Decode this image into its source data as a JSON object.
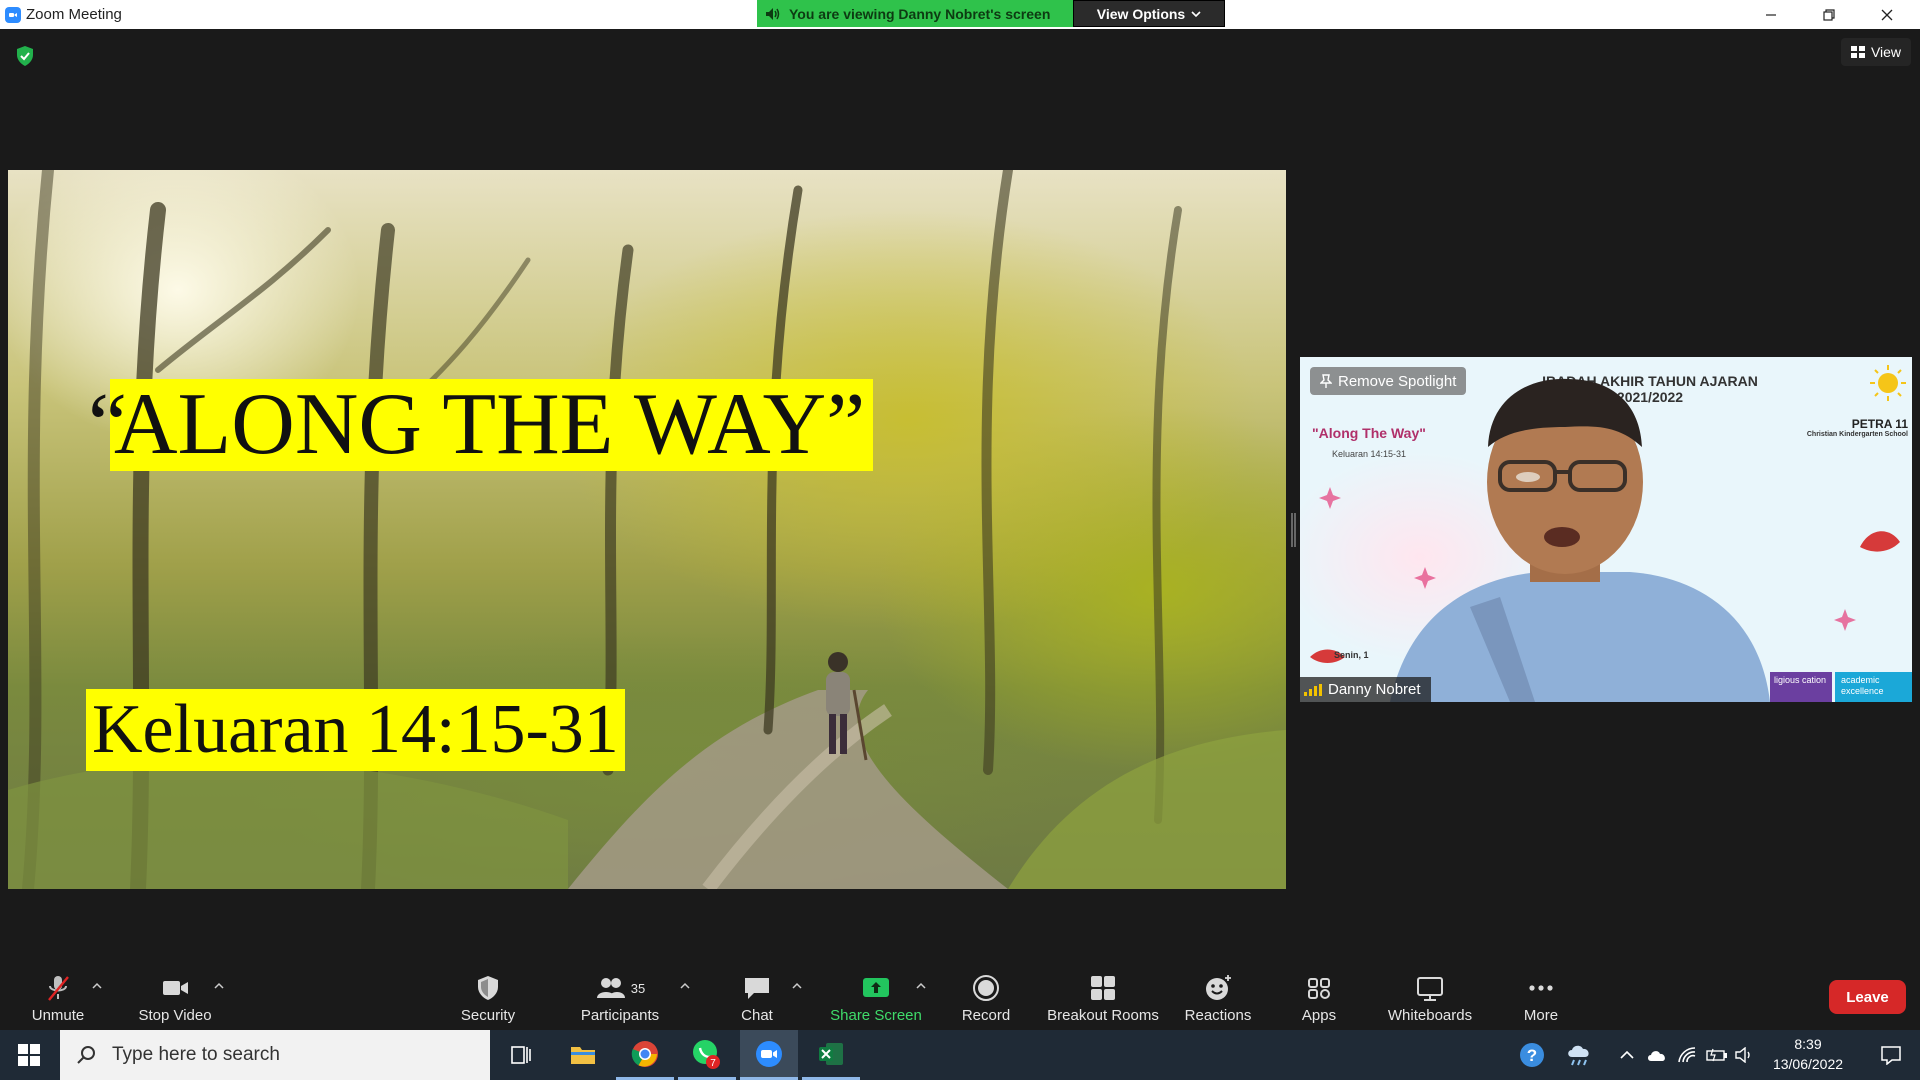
{
  "window": {
    "title": "Zoom Meeting",
    "viewing_banner": "You are viewing Danny Nobret's screen",
    "view_options_label": "View Options"
  },
  "main": {
    "view_button_label": "View"
  },
  "slide": {
    "title": "ALONG THE WAY”",
    "open_quote": "“",
    "reference": "Keluaran 14:15-31"
  },
  "speaker": {
    "name": "Danny Nobret",
    "remove_spotlight_label": "Remove Spotlight",
    "background": {
      "heading_line1": "IBADAH AKHIR TAHUN AJARAN",
      "heading_line2": "2021/2022",
      "brand": "PETRA 11",
      "brand_sub": "Christian Kindergarten School",
      "theme": "\"Along The Way\"",
      "verse": "Keluaran 14:15-31",
      "date_fragment": "Senin, 1",
      "tag1": "ligious cation",
      "tag2": "academic excellence"
    }
  },
  "toolbar": {
    "unmute": "Unmute",
    "stop_video": "Stop Video",
    "security": "Security",
    "participants": "Participants",
    "participants_count": "35",
    "chat": "Chat",
    "share_screen": "Share Screen",
    "record": "Record",
    "breakout_rooms": "Breakout Rooms",
    "reactions": "Reactions",
    "apps": "Apps",
    "whiteboards": "Whiteboards",
    "more": "More",
    "leave": "Leave"
  },
  "taskbar": {
    "search_placeholder": "Type here to search",
    "whatsapp_badge": "7",
    "time": "8:39",
    "date": "13/06/2022"
  },
  "colors": {
    "zoom_blue": "#2d8cff",
    "banner_green": "#2fc24b",
    "leave_red": "#d62828",
    "highlight_yellow": "#ffff00",
    "share_green": "#22c55e"
  }
}
